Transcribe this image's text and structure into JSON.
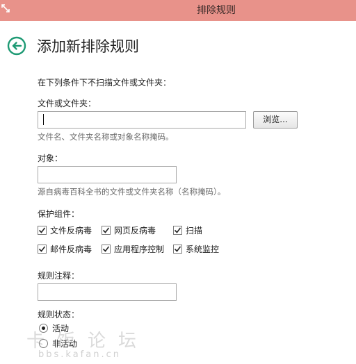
{
  "window": {
    "title": "排除规则"
  },
  "header": {
    "title": "添加新排除规则"
  },
  "intro_text": "在下列条件下不扫描文件或文件夹：",
  "file_section": {
    "label": "文件或文件夹：",
    "value": "",
    "browse_label": "浏览...",
    "hint": "文件名、文件夹名称或对象名称掩码。"
  },
  "object_section": {
    "label": "对象：",
    "value": "",
    "hint": "源自病毒百科全书的文件或文件夹名称（名称掩码）。"
  },
  "protection": {
    "label": "保护组件：",
    "components": [
      {
        "label": "文件反病毒",
        "checked": true
      },
      {
        "label": "网页反病毒",
        "checked": true
      },
      {
        "label": "扫描",
        "checked": true
      },
      {
        "label": "邮件反病毒",
        "checked": true
      },
      {
        "label": "应用程序控制",
        "checked": true
      },
      {
        "label": "系统监控",
        "checked": true
      }
    ]
  },
  "comment_section": {
    "label": "规则注释：",
    "value": ""
  },
  "status_section": {
    "label": "规则状态：",
    "options": [
      {
        "label": "活动",
        "selected": true
      },
      {
        "label": "非活动",
        "selected": false
      }
    ]
  },
  "watermark": {
    "main": "卡饭论坛",
    "sub": "bbs.kafan.cn"
  },
  "colors": {
    "titlebar": "#e8928a",
    "accent": "#1e9a74"
  }
}
